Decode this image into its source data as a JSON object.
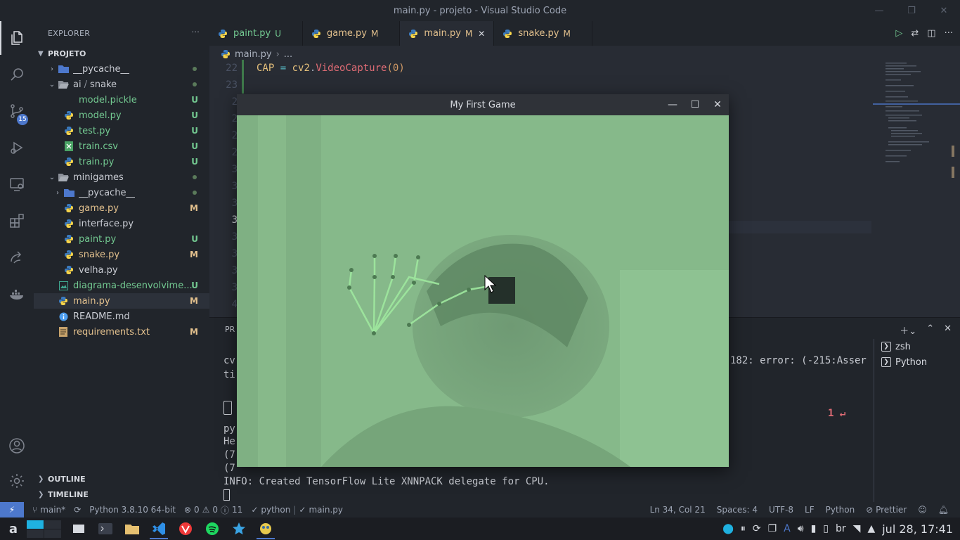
{
  "window": {
    "title": "main.py - projeto - Visual Studio Code"
  },
  "activity_bar": {
    "scm_badge": "15"
  },
  "sidebar": {
    "title": "EXPLORER",
    "more": "···",
    "root": "PROJETO",
    "items": [
      {
        "label": "__pycache__",
        "status": "",
        "dot": true,
        "level": 1,
        "kind": "folder-closed"
      },
      {
        "label": "ai",
        "label2": "snake",
        "status": "",
        "dot": true,
        "level": 1,
        "kind": "folder-open"
      },
      {
        "label": "model.pickle",
        "status": "U",
        "level": 2,
        "kind": "file"
      },
      {
        "label": "model.py",
        "status": "U",
        "level": 2,
        "kind": "python"
      },
      {
        "label": "test.py",
        "status": "U",
        "level": 2,
        "kind": "python"
      },
      {
        "label": "train.csv",
        "status": "U",
        "level": 2,
        "kind": "csv"
      },
      {
        "label": "train.py",
        "status": "U",
        "level": 2,
        "kind": "python"
      },
      {
        "label": "minigames",
        "status": "",
        "dot": true,
        "level": 1,
        "kind": "folder-open"
      },
      {
        "label": "__pycache__",
        "status": "",
        "dot": true,
        "level": 2,
        "kind": "folder-closed"
      },
      {
        "label": "game.py",
        "status": "M",
        "level": 2,
        "kind": "python"
      },
      {
        "label": "interface.py",
        "status": "",
        "level": 2,
        "kind": "python"
      },
      {
        "label": "paint.py",
        "status": "U",
        "level": 2,
        "kind": "python"
      },
      {
        "label": "snake.py",
        "status": "M",
        "level": 2,
        "kind": "python"
      },
      {
        "label": "velha.py",
        "status": "",
        "level": 2,
        "kind": "python"
      },
      {
        "label": "diagrama-desenvolvime...",
        "status": "U",
        "level": 1,
        "kind": "image"
      },
      {
        "label": "main.py",
        "status": "M",
        "level": 1,
        "kind": "python",
        "selected": true
      },
      {
        "label": "README.md",
        "status": "",
        "level": 1,
        "kind": "info"
      },
      {
        "label": "requirements.txt",
        "status": "M",
        "level": 1,
        "kind": "text"
      }
    ],
    "outline": "OUTLINE",
    "timeline": "TIMELINE"
  },
  "tabs": [
    {
      "label": "paint.py",
      "status": "U"
    },
    {
      "label": "game.py",
      "status": "M"
    },
    {
      "label": "main.py",
      "status": "M",
      "active": true,
      "close": "✕"
    },
    {
      "label": "snake.py",
      "status": "M"
    }
  ],
  "editor": {
    "breadcrumb_file": "main.py",
    "breadcrumb_rest": "...",
    "lines": [
      {
        "n": "22",
        "code_a": "CAP",
        "code_b": " = ",
        "code_c": "cv2",
        "code_d": ".",
        "code_e": "VideoCapture",
        "code_f": "(",
        "code_g": "0",
        "code_h": ")"
      },
      {
        "n": "23"
      },
      {
        "n": "2"
      },
      {
        "n": "2"
      },
      {
        "n": "2"
      },
      {
        "n": "2"
      },
      {
        "n": "3"
      },
      {
        "n": "3"
      },
      {
        "n": "3"
      },
      {
        "n": "3",
        "current": true
      },
      {
        "n": "3"
      },
      {
        "n": "3"
      },
      {
        "n": "3"
      },
      {
        "n": "3"
      },
      {
        "n": "4"
      }
    ]
  },
  "panel": {
    "tab_label": "PR",
    "lines": [
      {
        "left": "cv",
        "right": "182: error: (-215:Asser"
      },
      {
        "left": "ti"
      },
      {
        "left": "py"
      },
      {
        "left": "He"
      },
      {
        "left": "(7"
      },
      {
        "left": "(7"
      },
      {
        "full": "INFO: Created TensorFlow Lite XNNPACK delegate for CPU."
      }
    ],
    "prompt_exit": "1 ↵",
    "terminals": [
      "zsh",
      "Python"
    ]
  },
  "statusbar": {
    "branch": "main*",
    "interpreter": "Python 3.8.10 64-bit",
    "errors": "0",
    "warnings": "0",
    "info": "11",
    "check1": "python",
    "check2": "main.py",
    "position": "Ln 34, Col 21",
    "spaces": "Spaces: 4",
    "encoding": "UTF-8",
    "eol": "LF",
    "language": "Python",
    "formatter": "Prettier"
  },
  "game_window": {
    "title": "My First Game"
  },
  "taskbar": {
    "lang": "br",
    "clock": "jul 28, 17:41"
  }
}
